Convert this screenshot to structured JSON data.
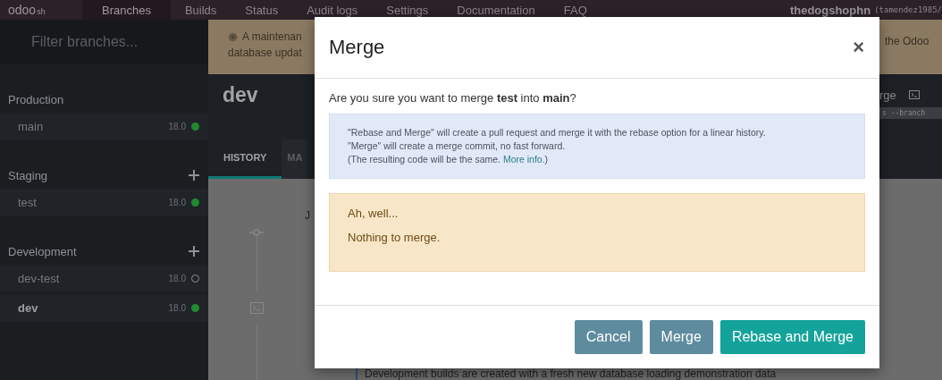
{
  "nav": {
    "logo": "odoo",
    "logo_suffix": "sh",
    "tabs": [
      {
        "label": "Branches",
        "selected": true
      },
      {
        "label": "Builds",
        "selected": false
      },
      {
        "label": "Status",
        "selected": false
      },
      {
        "label": "Audit logs",
        "selected": false
      },
      {
        "label": "Settings",
        "selected": false
      },
      {
        "label": "Documentation",
        "selected": false
      },
      {
        "label": "FAQ",
        "selected": false
      }
    ],
    "project": "thedogshophn",
    "account": "(tamendez1985/"
  },
  "sidebar": {
    "filter": {
      "placeholder": "Filter branches..."
    },
    "sections": [
      {
        "title": "Production",
        "can_add": false,
        "branches": [
          {
            "name": "main",
            "version": "18.0",
            "running": true,
            "selected": false
          }
        ]
      },
      {
        "title": "Staging",
        "can_add": true,
        "branches": [
          {
            "name": "test",
            "version": "18.0",
            "running": true,
            "selected": false
          }
        ]
      },
      {
        "title": "Development",
        "can_add": true,
        "branches": [
          {
            "name": "dev-test",
            "version": "18.0",
            "running": false,
            "selected": false
          },
          {
            "name": "dev",
            "version": "18.0",
            "running": true,
            "selected": true
          }
        ]
      }
    ]
  },
  "main": {
    "banner_lines": [
      "A maintenan",
      "database updat"
    ],
    "banner_right": "the Odoo",
    "title": "dev",
    "toolbar_right": "rge",
    "command_fragment": "s --branch",
    "tabs": [
      {
        "label": "HISTORY",
        "selected": true
      },
      {
        "label": "MA",
        "selected": false
      }
    ],
    "history_label": "J",
    "footer_note": "Development builds are created with a fresh new database loading demonstration data"
  },
  "modal": {
    "title": "Merge",
    "close": "×",
    "question": "Are you sure you want to merge **test** into **main**?",
    "info": {
      "lines": [
        "\"Rebase and Merge\" will create a pull request and merge it with the rebase option for a linear history.",
        "\"Merge\" will create a merge commit, no fast forward."
      ],
      "last_line": "(The resulting code will be the same.",
      "link": "More info.",
      "last_line_end": ")"
    },
    "warning": {
      "title": "Ah, well...",
      "message": "Nothing to merge."
    },
    "buttons": [
      {
        "label": "Cancel",
        "kind": "secondary"
      },
      {
        "label": "Merge",
        "kind": "secondary"
      },
      {
        "label": "Rebase and Merge",
        "kind": "primary"
      }
    ]
  }
}
